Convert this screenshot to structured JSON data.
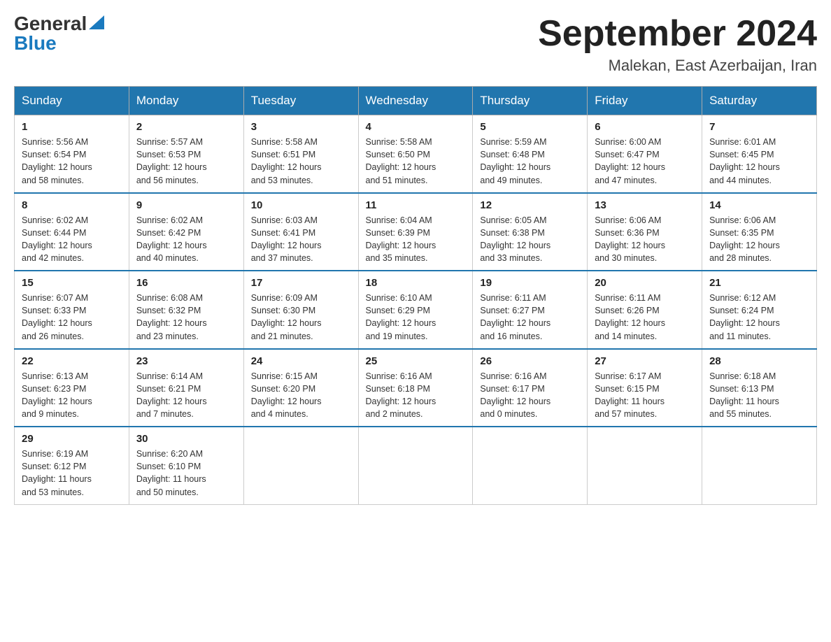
{
  "logo": {
    "general": "General",
    "triangle": "▶",
    "blue": "Blue"
  },
  "title": "September 2024",
  "subtitle": "Malekan, East Azerbaijan, Iran",
  "days_of_week": [
    "Sunday",
    "Monday",
    "Tuesday",
    "Wednesday",
    "Thursday",
    "Friday",
    "Saturday"
  ],
  "weeks": [
    [
      {
        "day": "1",
        "sunrise": "5:56 AM",
        "sunset": "6:54 PM",
        "daylight": "12 hours and 58 minutes."
      },
      {
        "day": "2",
        "sunrise": "5:57 AM",
        "sunset": "6:53 PM",
        "daylight": "12 hours and 56 minutes."
      },
      {
        "day": "3",
        "sunrise": "5:58 AM",
        "sunset": "6:51 PM",
        "daylight": "12 hours and 53 minutes."
      },
      {
        "day": "4",
        "sunrise": "5:58 AM",
        "sunset": "6:50 PM",
        "daylight": "12 hours and 51 minutes."
      },
      {
        "day": "5",
        "sunrise": "5:59 AM",
        "sunset": "6:48 PM",
        "daylight": "12 hours and 49 minutes."
      },
      {
        "day": "6",
        "sunrise": "6:00 AM",
        "sunset": "6:47 PM",
        "daylight": "12 hours and 47 minutes."
      },
      {
        "day": "7",
        "sunrise": "6:01 AM",
        "sunset": "6:45 PM",
        "daylight": "12 hours and 44 minutes."
      }
    ],
    [
      {
        "day": "8",
        "sunrise": "6:02 AM",
        "sunset": "6:44 PM",
        "daylight": "12 hours and 42 minutes."
      },
      {
        "day": "9",
        "sunrise": "6:02 AM",
        "sunset": "6:42 PM",
        "daylight": "12 hours and 40 minutes."
      },
      {
        "day": "10",
        "sunrise": "6:03 AM",
        "sunset": "6:41 PM",
        "daylight": "12 hours and 37 minutes."
      },
      {
        "day": "11",
        "sunrise": "6:04 AM",
        "sunset": "6:39 PM",
        "daylight": "12 hours and 35 minutes."
      },
      {
        "day": "12",
        "sunrise": "6:05 AM",
        "sunset": "6:38 PM",
        "daylight": "12 hours and 33 minutes."
      },
      {
        "day": "13",
        "sunrise": "6:06 AM",
        "sunset": "6:36 PM",
        "daylight": "12 hours and 30 minutes."
      },
      {
        "day": "14",
        "sunrise": "6:06 AM",
        "sunset": "6:35 PM",
        "daylight": "12 hours and 28 minutes."
      }
    ],
    [
      {
        "day": "15",
        "sunrise": "6:07 AM",
        "sunset": "6:33 PM",
        "daylight": "12 hours and 26 minutes."
      },
      {
        "day": "16",
        "sunrise": "6:08 AM",
        "sunset": "6:32 PM",
        "daylight": "12 hours and 23 minutes."
      },
      {
        "day": "17",
        "sunrise": "6:09 AM",
        "sunset": "6:30 PM",
        "daylight": "12 hours and 21 minutes."
      },
      {
        "day": "18",
        "sunrise": "6:10 AM",
        "sunset": "6:29 PM",
        "daylight": "12 hours and 19 minutes."
      },
      {
        "day": "19",
        "sunrise": "6:11 AM",
        "sunset": "6:27 PM",
        "daylight": "12 hours and 16 minutes."
      },
      {
        "day": "20",
        "sunrise": "6:11 AM",
        "sunset": "6:26 PM",
        "daylight": "12 hours and 14 minutes."
      },
      {
        "day": "21",
        "sunrise": "6:12 AM",
        "sunset": "6:24 PM",
        "daylight": "12 hours and 11 minutes."
      }
    ],
    [
      {
        "day": "22",
        "sunrise": "6:13 AM",
        "sunset": "6:23 PM",
        "daylight": "12 hours and 9 minutes."
      },
      {
        "day": "23",
        "sunrise": "6:14 AM",
        "sunset": "6:21 PM",
        "daylight": "12 hours and 7 minutes."
      },
      {
        "day": "24",
        "sunrise": "6:15 AM",
        "sunset": "6:20 PM",
        "daylight": "12 hours and 4 minutes."
      },
      {
        "day": "25",
        "sunrise": "6:16 AM",
        "sunset": "6:18 PM",
        "daylight": "12 hours and 2 minutes."
      },
      {
        "day": "26",
        "sunrise": "6:16 AM",
        "sunset": "6:17 PM",
        "daylight": "12 hours and 0 minutes."
      },
      {
        "day": "27",
        "sunrise": "6:17 AM",
        "sunset": "6:15 PM",
        "daylight": "11 hours and 57 minutes."
      },
      {
        "day": "28",
        "sunrise": "6:18 AM",
        "sunset": "6:13 PM",
        "daylight": "11 hours and 55 minutes."
      }
    ],
    [
      {
        "day": "29",
        "sunrise": "6:19 AM",
        "sunset": "6:12 PM",
        "daylight": "11 hours and 53 minutes."
      },
      {
        "day": "30",
        "sunrise": "6:20 AM",
        "sunset": "6:10 PM",
        "daylight": "11 hours and 50 minutes."
      },
      null,
      null,
      null,
      null,
      null
    ]
  ]
}
